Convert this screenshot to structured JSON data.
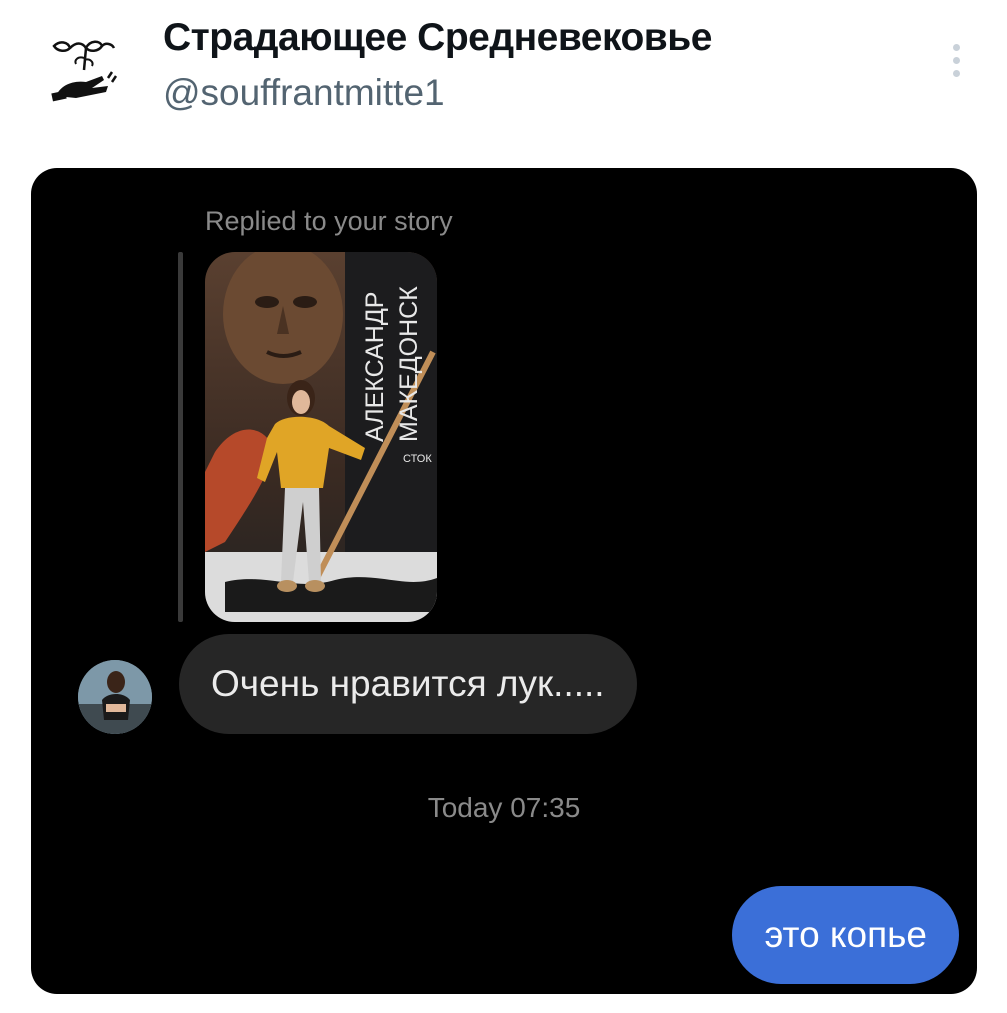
{
  "tweet": {
    "display_name": "Страдающее Средневековье",
    "handle": "@souffrantmitte1",
    "logo_icon": "medieval-seedling-hand-icon",
    "more_icon": "vertical-ellipsis-icon"
  },
  "chat": {
    "replied_label": "Replied to your story",
    "story_poster_text": {
      "line1": "АЛЕКСАНДР",
      "line2": "МАКЕДОНСК",
      "line3": "СТОК"
    },
    "incoming_message": "Очень нравится лук.....",
    "timestamp": "Today 07:35",
    "outgoing_message": "это копье",
    "colors": {
      "background": "#000000",
      "incoming_bubble": "#262626",
      "outgoing_bubble": "#3b6fd8"
    }
  }
}
